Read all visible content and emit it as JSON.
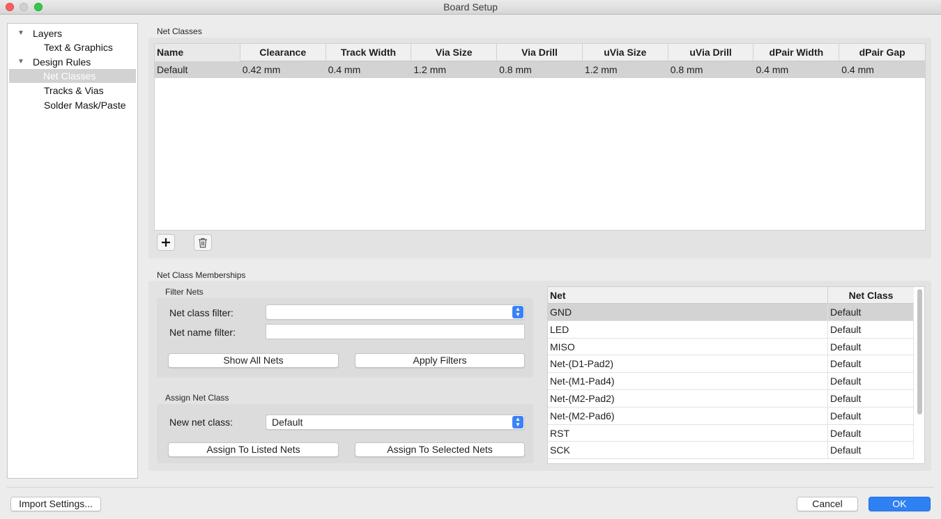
{
  "window": {
    "title": "Board Setup"
  },
  "sidebar": {
    "items": [
      {
        "label": "Layers",
        "expanded": true
      },
      {
        "label": "Text & Graphics"
      },
      {
        "label": "Design Rules",
        "expanded": true
      },
      {
        "label": "Net Classes",
        "selected": true
      },
      {
        "label": "Tracks & Vias"
      },
      {
        "label": "Solder Mask/Paste"
      }
    ]
  },
  "net_classes": {
    "section_label": "Net Classes",
    "columns": [
      "Name",
      "Clearance",
      "Track Width",
      "Via Size",
      "Via Drill",
      "uVia Size",
      "uVia Drill",
      "dPair Width",
      "dPair Gap"
    ],
    "rows": [
      [
        "Default",
        "0.42 mm",
        "0.4 mm",
        "1.2 mm",
        "0.8 mm",
        "1.2 mm",
        "0.8 mm",
        "0.4 mm",
        "0.4 mm"
      ]
    ],
    "add_icon": "plus-icon",
    "delete_icon": "trash-icon"
  },
  "memberships": {
    "section_label": "Net Class Memberships",
    "filter": {
      "label": "Filter Nets",
      "net_class_filter_label": "Net class filter:",
      "net_class_filter_value": "",
      "net_name_filter_label": "Net name filter:",
      "net_name_filter_value": "",
      "show_all_label": "Show All Nets",
      "apply_label": "Apply Filters"
    },
    "assign": {
      "label": "Assign Net Class",
      "new_net_class_label": "New net class:",
      "new_net_class_value": "Default",
      "assign_listed_label": "Assign To Listed Nets",
      "assign_selected_label": "Assign To Selected Nets"
    },
    "net_table": {
      "columns": [
        "Net",
        "Net Class"
      ],
      "rows": [
        [
          "GND",
          "Default"
        ],
        [
          "LED",
          "Default"
        ],
        [
          "MISO",
          "Default"
        ],
        [
          "Net-(D1-Pad2)",
          "Default"
        ],
        [
          "Net-(M1-Pad4)",
          "Default"
        ],
        [
          "Net-(M2-Pad2)",
          "Default"
        ],
        [
          "Net-(M2-Pad6)",
          "Default"
        ],
        [
          "RST",
          "Default"
        ],
        [
          "SCK",
          "Default"
        ]
      ]
    }
  },
  "footer": {
    "import_label": "Import Settings...",
    "cancel_label": "Cancel",
    "ok_label": "OK"
  },
  "colors": {
    "accent": "#2f80f2",
    "selection_row": "#d3d3d3",
    "close": "#fc605c",
    "maximize": "#34c84a"
  }
}
